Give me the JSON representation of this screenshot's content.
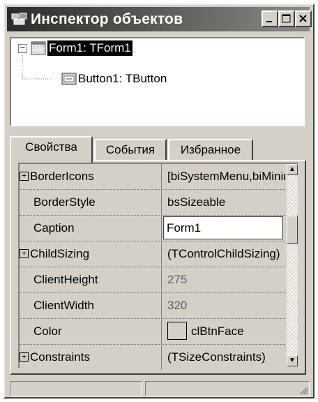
{
  "window": {
    "title": "Инспектор объектов",
    "controls": {
      "minimize": "_",
      "maximize": "□",
      "close": "X"
    }
  },
  "tree": {
    "expander": "−",
    "items": [
      {
        "label": "Form1: TForm1",
        "selected": true,
        "icon": "form-icon"
      },
      {
        "label": "Button1: TButton",
        "selected": false,
        "icon": "button-icon"
      }
    ]
  },
  "tabs": [
    {
      "label": "Свойства",
      "active": true
    },
    {
      "label": "События",
      "active": false
    },
    {
      "label": "Избранное",
      "active": false
    }
  ],
  "properties": [
    {
      "name": "BorderIcons",
      "expandable": true,
      "value": "[biSystemMenu,biMinimize,biMaximize]"
    },
    {
      "name": "BorderStyle",
      "expandable": false,
      "value": "bsSizeable"
    },
    {
      "name": "Caption",
      "expandable": false,
      "value": "Form1",
      "editing": true
    },
    {
      "name": "ChildSizing",
      "expandable": true,
      "value": "(TControlChildSizing)"
    },
    {
      "name": "ClientHeight",
      "expandable": false,
      "value": "275",
      "dim": true
    },
    {
      "name": "ClientWidth",
      "expandable": false,
      "value": "320",
      "dim": true
    },
    {
      "name": "Color",
      "expandable": false,
      "value": "clBtnFace",
      "swatch": "#d4d0c8"
    },
    {
      "name": "Constraints",
      "expandable": true,
      "value": "(TSizeConstraints)"
    }
  ],
  "expander_plus": "+",
  "scrollbar": {
    "up": "▲",
    "down": "▼",
    "position_fraction": 0.35
  },
  "colors": {
    "title_start": "#2b2b2b",
    "title_end": "#8a8a8a",
    "face": "#d4d0c8",
    "selection": "#000000"
  }
}
